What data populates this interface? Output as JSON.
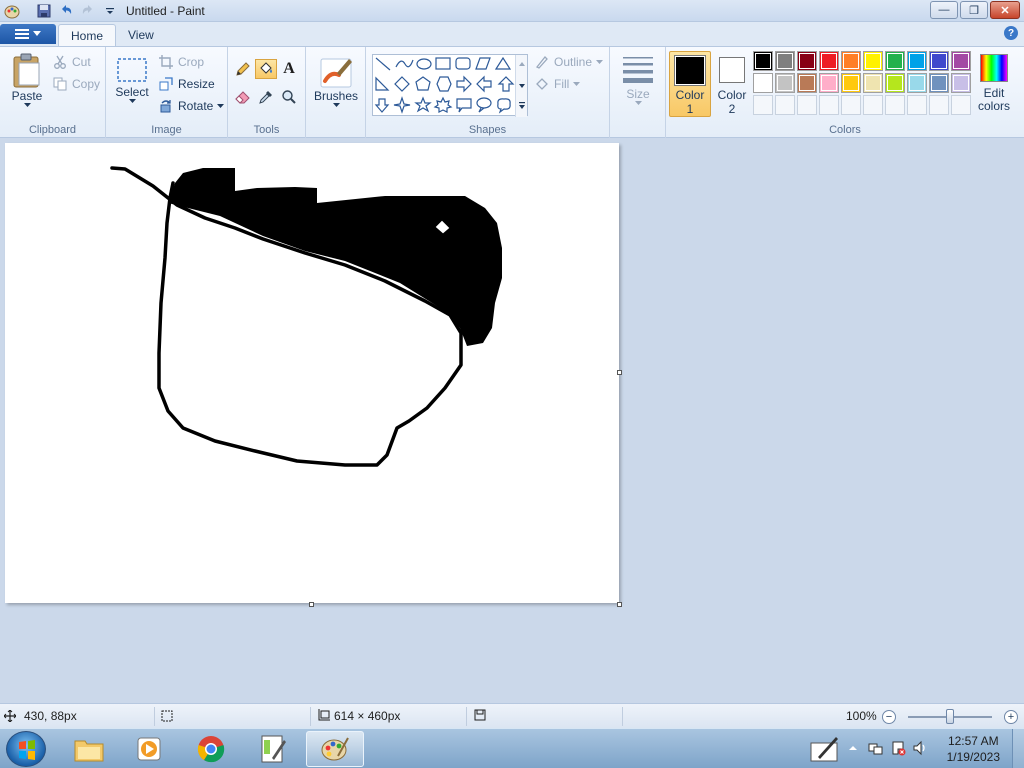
{
  "window": {
    "title": "Untitled - Paint",
    "buttons": {
      "minimize": "—",
      "maximize": "❐",
      "close": "✕"
    }
  },
  "tabs": [
    {
      "label": "Home",
      "active": true
    },
    {
      "label": "View",
      "active": false
    }
  ],
  "ribbon": {
    "clipboard": {
      "label": "Clipboard",
      "paste": "Paste",
      "cut": "Cut",
      "copy": "Copy"
    },
    "image": {
      "label": "Image",
      "select": "Select",
      "crop": "Crop",
      "resize": "Resize",
      "rotate": "Rotate"
    },
    "tools": {
      "label": "Tools",
      "text_glyph": "A"
    },
    "brushes": {
      "label": "Brushes"
    },
    "shapes": {
      "label": "Shapes",
      "outline": "Outline",
      "fill": "Fill"
    },
    "size": {
      "label": "Size"
    },
    "colors": {
      "label": "Colors",
      "color1_line1": "Color",
      "color1_line2": "1",
      "color2_line1": "Color",
      "color2_line2": "2",
      "edit_line1": "Edit",
      "edit_line2": "colors",
      "color1": "#000000",
      "color2": "#ffffff",
      "palette_row1": [
        "#000000",
        "#7f7f7f",
        "#880015",
        "#ed1c24",
        "#ff7f27",
        "#fff200",
        "#22b14c",
        "#00a2e8",
        "#3f48cc",
        "#a349a4"
      ],
      "palette_row2": [
        "#ffffff",
        "#c3c3c3",
        "#b97a57",
        "#ffaec9",
        "#ffc90e",
        "#efe4b0",
        "#b5e61d",
        "#99d9ea",
        "#7092be",
        "#c8bfe7"
      ]
    }
  },
  "status": {
    "cursor_pos": "430, 88px",
    "canvas_size": "614 × 460px",
    "zoom": "100%"
  },
  "taskbar": {
    "time": "12:57 AM",
    "date": "1/19/2023"
  }
}
